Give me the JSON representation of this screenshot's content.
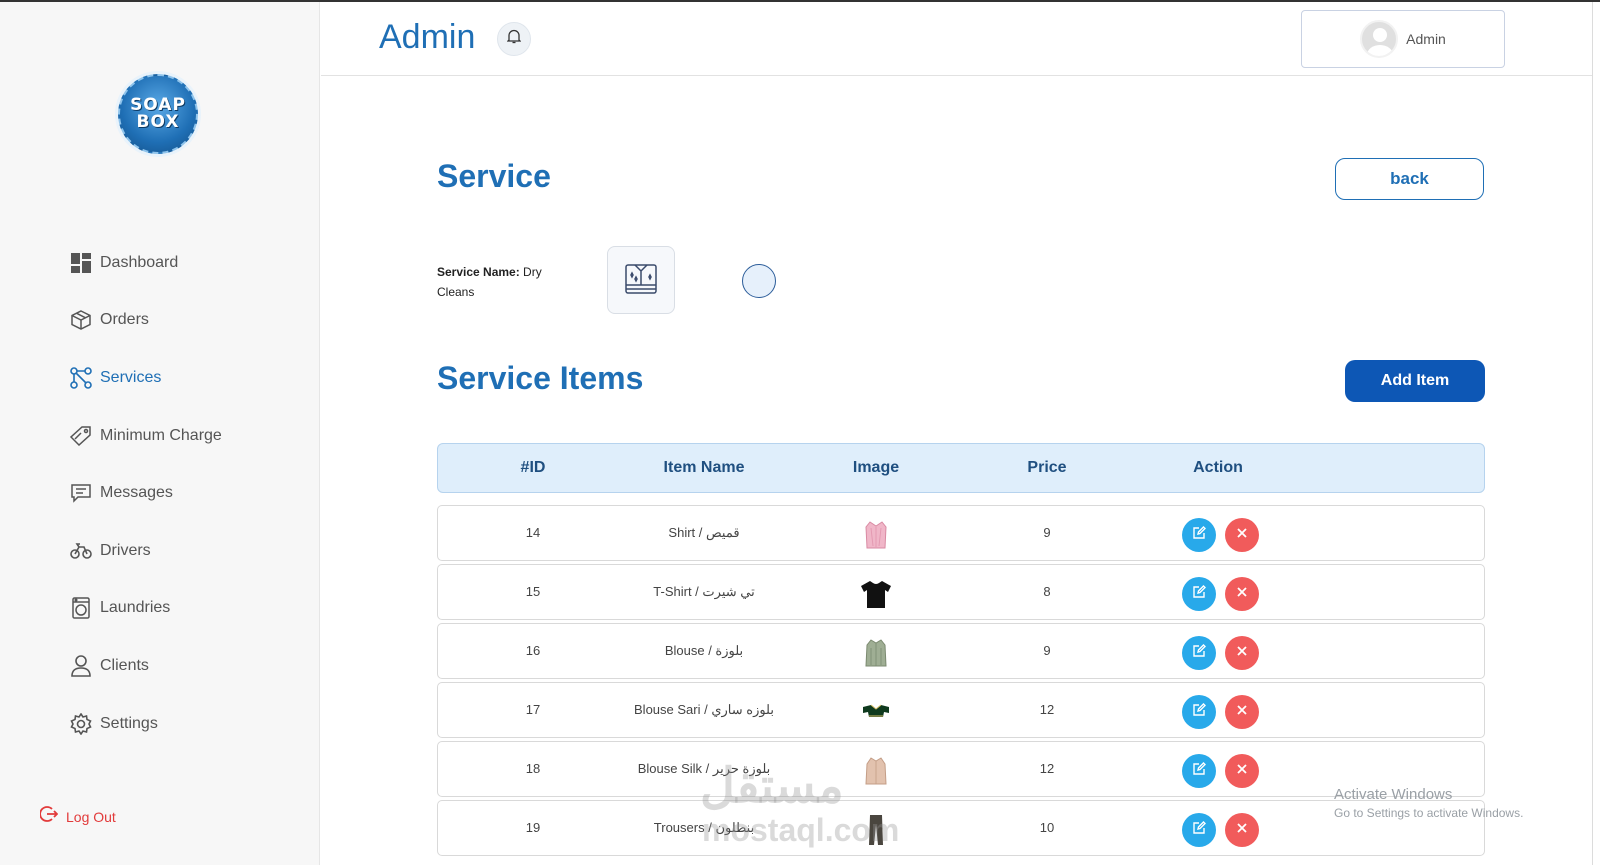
{
  "sidebar": {
    "logo_line1": "SOAP",
    "logo_line2": "BOX",
    "items": [
      {
        "label": "Dashboard",
        "icon": "dashboard-icon"
      },
      {
        "label": "Orders",
        "icon": "box-icon"
      },
      {
        "label": "Services",
        "icon": "services-icon"
      },
      {
        "label": "Minimum Charge",
        "icon": "tag-icon"
      },
      {
        "label": "Messages",
        "icon": "message-icon"
      },
      {
        "label": "Drivers",
        "icon": "bike-icon"
      },
      {
        "label": "Laundries",
        "icon": "washer-icon"
      },
      {
        "label": "Clients",
        "icon": "user-icon"
      },
      {
        "label": "Settings",
        "icon": "gear-icon"
      }
    ],
    "active": "Services",
    "logout_label": "Log Out"
  },
  "header": {
    "title": "Admin",
    "user_name": "Admin"
  },
  "service": {
    "title": "Service",
    "back_label": "back",
    "name_label": "Service Name:",
    "name_value": " Dry Cleans"
  },
  "items": {
    "title": "Service Items",
    "add_label": "Add Item",
    "columns": [
      "#ID",
      "Item Name",
      "Image",
      "Price",
      "Action"
    ],
    "rows": [
      {
        "id": "14",
        "name": "Shirt / قميص",
        "price": "9",
        "image": "pink-shirt"
      },
      {
        "id": "15",
        "name": "T-Shirt / تي شيرت",
        "price": "8",
        "image": "black-tshirt"
      },
      {
        "id": "16",
        "name": "Blouse / بلوزة",
        "price": "9",
        "image": "green-blouse"
      },
      {
        "id": "17",
        "name": "Blouse Sari / بلوزه ساري",
        "price": "12",
        "image": "sari-blouse"
      },
      {
        "id": "18",
        "name": "Blouse Silk / بلوزة حرير",
        "price": "12",
        "image": "silk-blouse"
      },
      {
        "id": "19",
        "name": "Trousers / بنطلون",
        "price": "10",
        "image": "trousers"
      }
    ]
  },
  "watermark": {
    "activate_title": "Activate Windows",
    "activate_sub": "Go to Settings to activate Windows.",
    "brand": "مستقل",
    "url": "mostaql.com"
  },
  "colors": {
    "primary": "#1f6fb5",
    "primary_dark": "#0d57b5",
    "edit": "#28a9ea",
    "delete": "#f15b5b",
    "logout": "#e23b3b"
  }
}
